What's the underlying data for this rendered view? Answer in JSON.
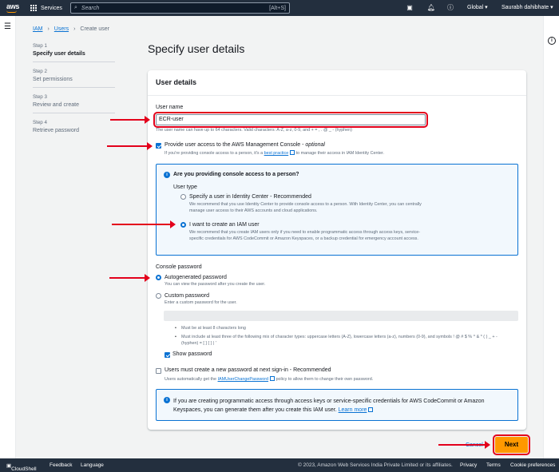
{
  "topnav": {
    "logo": "aws",
    "services": "Services",
    "search_placeholder": "Search",
    "search_shortcut": "[Alt+S]",
    "region": "Global ▾",
    "user": "Saurabh dahibhate ▾",
    "icons": [
      "cloudshell-icon",
      "bell-icon",
      "help-icon",
      "settings-icon"
    ]
  },
  "breadcrumb": {
    "items": [
      "IAM",
      "Users",
      "Create user"
    ]
  },
  "steps": [
    {
      "num": "Step 1",
      "label": "Specify user details"
    },
    {
      "num": "Step 2",
      "label": "Set permissions"
    },
    {
      "num": "Step 3",
      "label": "Review and create"
    },
    {
      "num": "Step 4",
      "label": "Retrieve password"
    }
  ],
  "page": {
    "title": "Specify user details"
  },
  "panel": {
    "title": "User details",
    "username_label": "User name",
    "username_value": "ECR-user",
    "username_hint": "The user name can have up to 64 characters. Valid characters: A-Z, a-z, 0-9, and + = , . @ _ - (hyphen)",
    "console_access_label": "Provide user access to the AWS Management Console -",
    "console_access_optional": "optional",
    "console_access_hint": "If you're providing console access to a person, it's a",
    "console_access_hint_link": "best practice",
    "console_access_hint_tail": "to manage their access in IAM Identity Center.",
    "infobox": {
      "title": "Are you providing console access to a person?",
      "user_type": "User type",
      "opt1_label": "Specify a user in Identity Center - Recommended",
      "opt1_desc": "We recommend that you use Identity Center to provide console access to a person. With Identity Center, you can centrally manage user access to their AWS accounts and cloud applications.",
      "opt2_label": "I want to create an IAM user",
      "opt2_desc": "We recommend that you create IAM users only if you need to enable programmatic access through access keys, service-specific credentials for AWS CodeCommit or Amazon Keyspaces, or a backup credential for emergency account access."
    },
    "console_password": "Console password",
    "autogen_label": "Autogenerated password",
    "autogen_desc": "You can view the password after you create the user.",
    "custom_label": "Custom password",
    "custom_desc": "Enter a custom password for the user.",
    "rule1": "Must be at least 8 characters long",
    "rule2": "Must include at least three of the following mix of character types: uppercase letters (A-Z), lowercase letters (a-z), numbers (0-9), and symbols ! @ # $ % ^ & * ( ) _ + - (hyphen) = [ ] { } | '",
    "show_password": "Show password",
    "reset_label": "Users must create a new password at next sign-in - Recommended",
    "reset_desc_pre": "Users automatically get the",
    "reset_desc_link": "IAMUserChangePassword",
    "reset_desc_post": "policy to allow them to change their own password.",
    "info2": "If you are creating programmatic access through access keys or service-specific credentials for AWS CodeCommit or Amazon Keyspaces, you can generate them after you create this IAM user.",
    "info2_link": "Learn more"
  },
  "actions": {
    "cancel": "Cancel",
    "next": "Next"
  },
  "footer": {
    "cloudshell": "CloudShell",
    "feedback": "Feedback",
    "language": "Language",
    "copyright": "© 2023, Amazon Web Services India Private Limited or its affiliates.",
    "privacy": "Privacy",
    "terms": "Terms",
    "cookies": "Cookie preferences"
  },
  "colors": {
    "accent": "#0972d3",
    "nav": "#232f3e",
    "primary_button": "#ff9900",
    "annotation": "#e3001b"
  }
}
